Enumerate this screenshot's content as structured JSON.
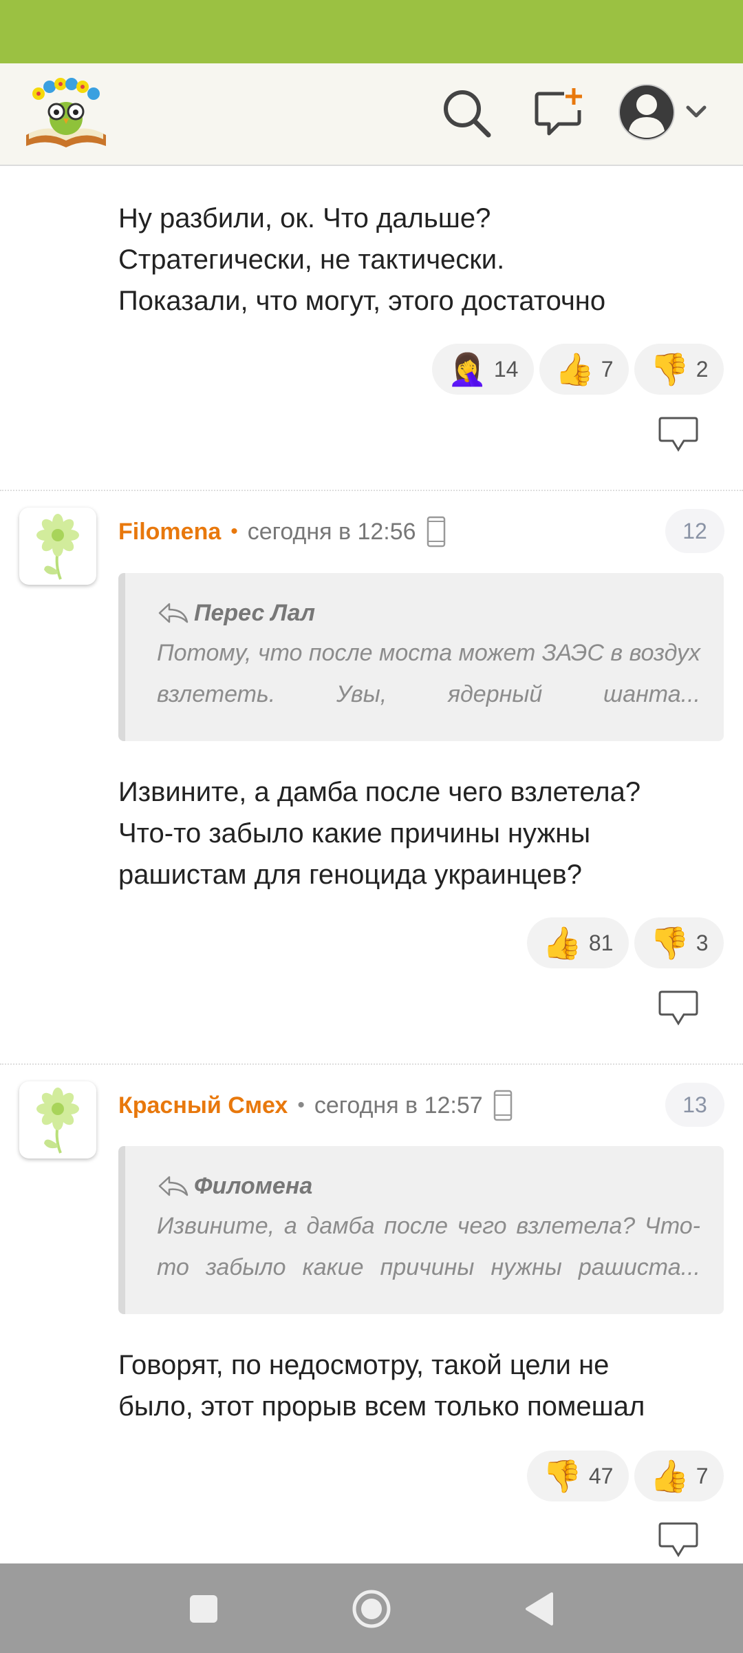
{
  "header": {
    "logo_icon": "owl-book-logo",
    "search_icon": "search-icon",
    "new_message_icon": "new-message-icon",
    "profile_icon": "user-avatar-icon",
    "dropdown_icon": "chevron-down-icon"
  },
  "comments": [
    {
      "text_lines": [
        "Ну разбили, ок. Что дальше?",
        "Стратегически, не тактически.",
        "Показали, что могут, этого достаточно"
      ],
      "reactions": [
        {
          "icon": "facepalm",
          "count": "14"
        },
        {
          "icon": "thumbs-up",
          "count": "7"
        },
        {
          "icon": "thumbs-down",
          "count": "2"
        }
      ]
    },
    {
      "author": "Filomena",
      "time": "сегодня в 12:56",
      "number": "12",
      "quote_author": "Перес Лал",
      "quote_text": "Потому, что после моста может ЗАЭС в воздух взлететь. Увы, ядерный шанта...",
      "text_lines": [
        "Извините, а дамба после чего взлетела?",
        "Что-то забыло какие причины нужны",
        "рашистам для геноцида украинцев?"
      ],
      "reactions": [
        {
          "icon": "thumbs-up",
          "count": "81"
        },
        {
          "icon": "thumbs-down",
          "count": "3"
        }
      ]
    },
    {
      "author": "Красный Смех",
      "time": "сегодня в 12:57",
      "number": "13",
      "quote_author": "Филомена",
      "quote_text": "Извините, а дамба после чего взлетела? Что-то забыло какие причины нужны рашиста...",
      "text_lines": [
        "Говорят, по недосмотру, такой цели не",
        "было, этот прорыв всем только помешал"
      ],
      "reactions": [
        {
          "icon": "thumbs-down",
          "count": "47"
        },
        {
          "icon": "thumbs-up",
          "count": "7"
        }
      ]
    }
  ],
  "colors": {
    "status_bar": "#9bc142",
    "author": "#e8780c",
    "nav_bar": "#9c9c9c"
  }
}
